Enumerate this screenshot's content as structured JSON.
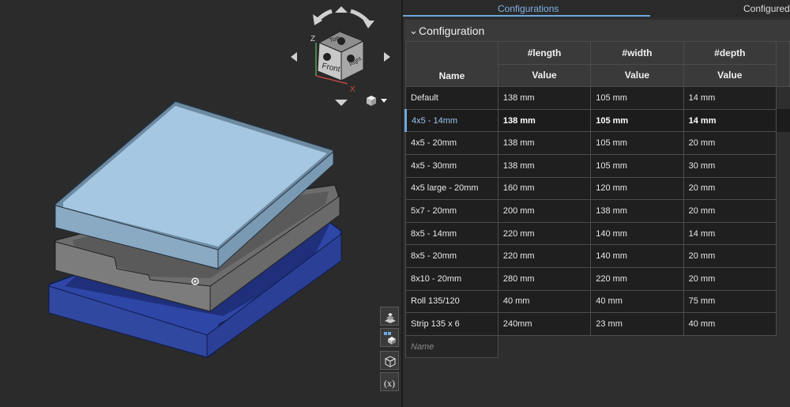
{
  "tabs": {
    "configurations": "Configurations",
    "configured_parts": "Configured p"
  },
  "section": {
    "title": "Configuration"
  },
  "viewcube": {
    "top": "Top",
    "front": "Front",
    "right": "Right",
    "axis_z": "Z",
    "axis_x": "X"
  },
  "table": {
    "name_header": "Name",
    "value_header": "Value",
    "params": [
      "#length",
      "#width",
      "#depth"
    ],
    "rows": [
      {
        "name": "Default",
        "length": "138 mm",
        "width": "105 mm",
        "depth": "14 mm",
        "selected": false
      },
      {
        "name": "4x5 - 14mm",
        "length": "138 mm",
        "width": "105 mm",
        "depth": "14 mm",
        "selected": true
      },
      {
        "name": "4x5 - 20mm",
        "length": "138 mm",
        "width": "105 mm",
        "depth": "20 mm",
        "selected": false
      },
      {
        "name": "4x5 - 30mm",
        "length": "138 mm",
        "width": "105 mm",
        "depth": "30 mm",
        "selected": false
      },
      {
        "name": "4x5 large - 20mm",
        "length": "160 mm",
        "width": "120 mm",
        "depth": "20 mm",
        "selected": false
      },
      {
        "name": "5x7 - 20mm",
        "length": "200 mm",
        "width": "138 mm",
        "depth": "20 mm",
        "selected": false
      },
      {
        "name": "8x5 - 14mm",
        "length": "220 mm",
        "width": "140 mm",
        "depth": "14 mm",
        "selected": false
      },
      {
        "name": "8x5 - 20mm",
        "length": "220 mm",
        "width": "140 mm",
        "depth": "20 mm",
        "selected": false
      },
      {
        "name": "8x10 - 20mm",
        "length": "280 mm",
        "width": "220 mm",
        "depth": "20 mm",
        "selected": false
      },
      {
        "name": "Roll 135/120",
        "length": "40 mm",
        "width": "40 mm",
        "depth": "75 mm",
        "selected": false
      },
      {
        "name": "Strip 135 x 6",
        "length": "240mm",
        "width": "23 mm",
        "depth": "40 mm",
        "selected": false
      }
    ],
    "new_row_placeholder": "Name"
  },
  "toolbar_icons": [
    "render-mode-icon",
    "view-cube-icon",
    "explode-icon",
    "variables-icon"
  ],
  "colors": {
    "accent": "#6fa8dc",
    "tray_top": "#9ec3df",
    "tray_middle": "#7a7a7a",
    "tray_bottom": "#2f47a8"
  }
}
